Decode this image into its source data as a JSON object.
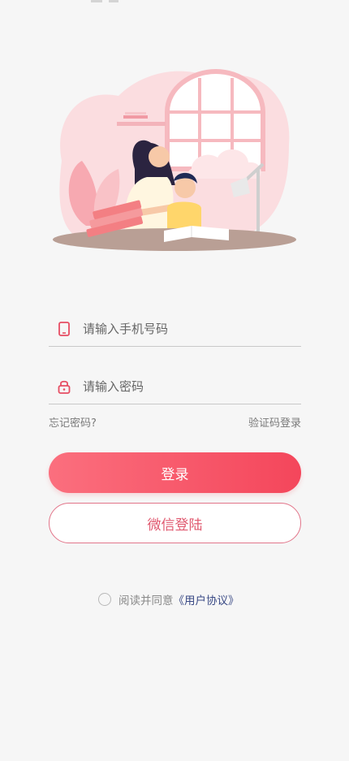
{
  "colors": {
    "accent": "#f4465b",
    "accent_light": "#fb6f7e",
    "link": "#3b4b86",
    "background": "#f6f6f6"
  },
  "illustration": {
    "icon": "mother-child-studying-illustration"
  },
  "phone": {
    "placeholder": "请输入手机号码",
    "icon": "phone-icon"
  },
  "password": {
    "placeholder": "请输入密码",
    "icon": "lock-icon"
  },
  "links": {
    "forgot": "忘记密码?",
    "sms_login": "验证码登录"
  },
  "buttons": {
    "login": "登录",
    "wechat": "微信登陆"
  },
  "agreement": {
    "prefix": "阅读并同意",
    "link": "《用户协议》",
    "checked": false
  }
}
